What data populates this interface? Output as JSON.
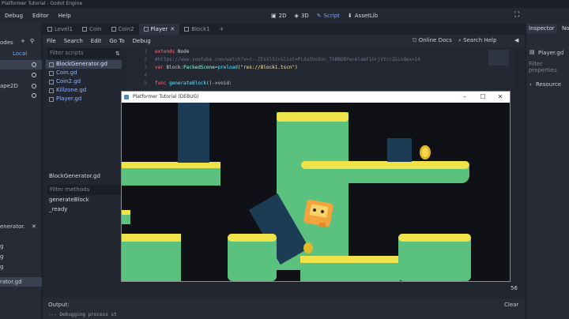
{
  "window": {
    "title": "Platformer Tutorial - Godot Engine"
  },
  "menu": {
    "items": [
      "Debug",
      "Editor",
      "Help"
    ],
    "modes": [
      {
        "label": "2D",
        "icon": "2d-icon"
      },
      {
        "label": "3D",
        "icon": "3d-icon"
      },
      {
        "label": "Script",
        "icon": "script-icon"
      },
      {
        "label": "AssetLib",
        "icon": "assetlib-icon"
      }
    ]
  },
  "left_dock": {
    "top_label": "odes",
    "tab_label": "Local",
    "node_row": "ape2D",
    "bottom_title": "enerator.",
    "list": [
      "g",
      "g",
      "g"
    ],
    "selected": "rator.gd"
  },
  "scene_tabs": [
    {
      "label": "Level1"
    },
    {
      "label": "Coin"
    },
    {
      "label": "Coin2"
    },
    {
      "label": "Player"
    },
    {
      "label": "Block1"
    }
  ],
  "script_menu": [
    "File",
    "Search",
    "Edit",
    "Go To",
    "Debug"
  ],
  "script_right": {
    "docs": "Online Docs",
    "search_help": "Search Help"
  },
  "scripts": {
    "filter_placeholder": "Filter scripts",
    "items": [
      "BlockGenerator.gd",
      "Coin.gd",
      "Coin2.gd",
      "Killzone.gd",
      "Player.gd"
    ],
    "current": "BlockGenerator.gd",
    "methods_placeholder": "Filter methods",
    "methods": [
      "generateBlock",
      "_ready"
    ]
  },
  "code": {
    "lines": [
      {
        "n": "1",
        "kw": "extends",
        "rest": " Node"
      },
      {
        "n": "2",
        "comment": "#https://www.youtube.com/watch?v=z--IEsXl5zc&list=PLda3VoSoc_TSBBOBYwcmlamF1UrjVtccZ&index=14"
      },
      {
        "n": "3",
        "kw": "var",
        "name": " Block:",
        "type": "PackedScene",
        "eq": "=",
        "fn": "preload",
        "str": "(\"res://Block1.tscn\")"
      },
      {
        "n": "4",
        "empty": ""
      },
      {
        "n": "5",
        "kw": "func",
        "name": " generateBlock",
        "rest": "()->void:"
      }
    ]
  },
  "inspector": {
    "tab": "Inspector",
    "tab2": "No",
    "file": "Player.gd",
    "filter": "Filter properties",
    "resource": "Resource"
  },
  "output": {
    "label": "Output:",
    "text": "--- Debugging process st",
    "clear": "Clear",
    "right_num": "56"
  },
  "game_window": {
    "title": "Platformer Tutorial (DEBUG)"
  },
  "colors": {
    "accent": "#6ea8ff",
    "grass": "#5bc17e",
    "grass_top": "#f0e24a",
    "block": "#1c3b55",
    "bg": "#0f1117"
  }
}
